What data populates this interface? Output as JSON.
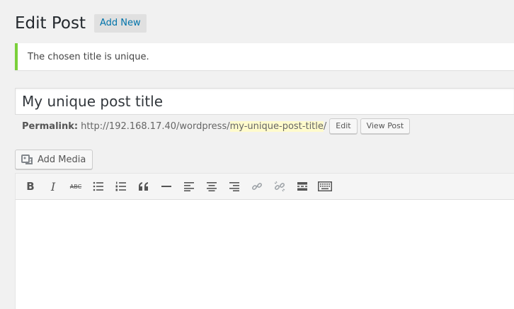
{
  "header": {
    "title": "Edit Post",
    "add_new_label": "Add New"
  },
  "notice": {
    "text": "The chosen title is unique.",
    "color": "#7ad03a"
  },
  "title_field": {
    "value": "My unique post title"
  },
  "permalink": {
    "label": "Permalink:",
    "base": "http://192.168.17.40/wordpress/",
    "slug": "my-unique-post-title",
    "suffix": "/",
    "edit_label": "Edit",
    "view_label": "View Post"
  },
  "add_media": {
    "label": "Add Media",
    "icon": "add-media-icon"
  },
  "toolbar": {
    "bold": "B",
    "italic": "I",
    "strikethrough": "ABC",
    "buttons": [
      "bold-icon",
      "italic-icon",
      "strikethrough-icon",
      "bulleted-list-icon",
      "numbered-list-icon",
      "blockquote-icon",
      "horizontal-line-icon",
      "align-left-icon",
      "align-center-icon",
      "align-right-icon",
      "insert-link-icon",
      "remove-link-icon",
      "read-more-icon",
      "toolbar-toggle-icon"
    ]
  },
  "colors": {
    "link": "#0073aa",
    "notice_border": "#7ad03a",
    "slug_highlight": "#fffbcc"
  }
}
